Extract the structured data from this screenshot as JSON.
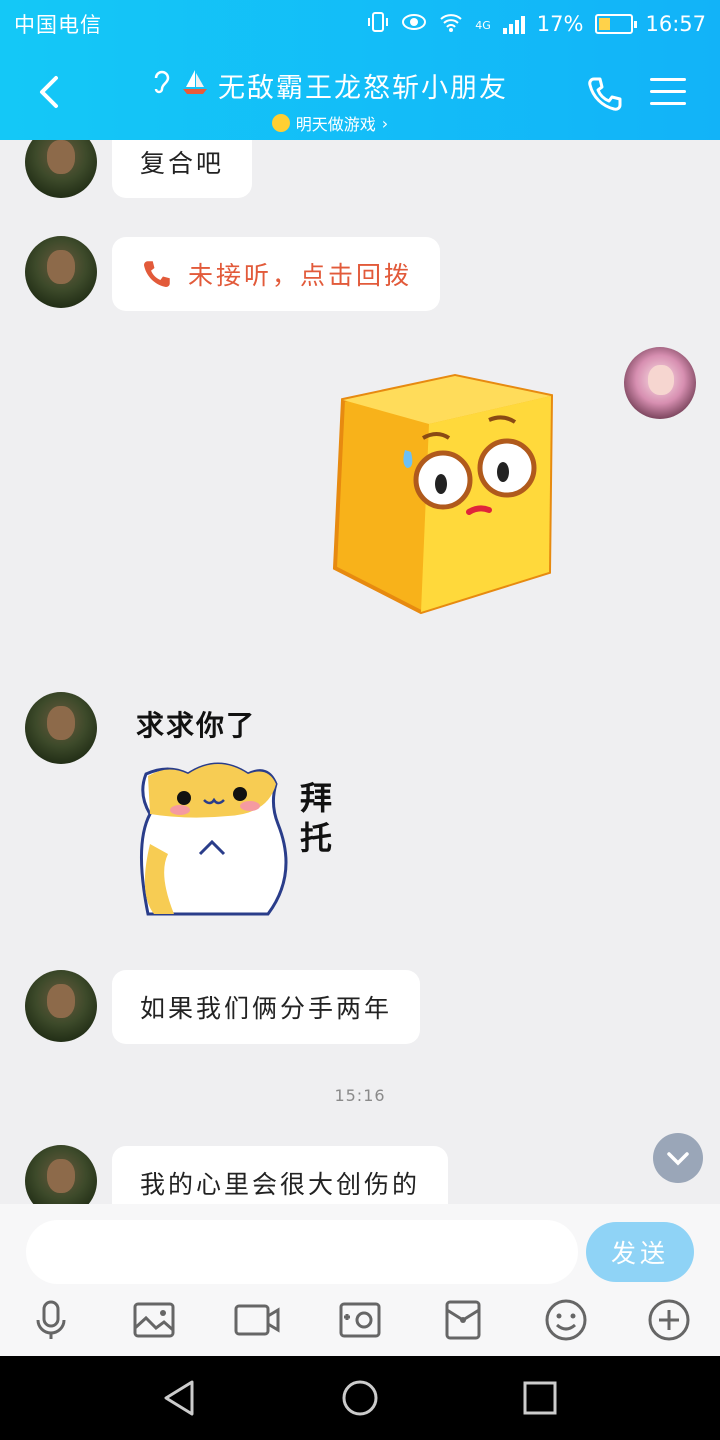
{
  "status_bar": {
    "carrier": "中国电信",
    "network": "4G",
    "battery": "17%",
    "time": "16:57"
  },
  "header": {
    "title": "无敌霸王龙怒斩小朋友",
    "subtitle": "明天做游戏"
  },
  "messages": {
    "m1": "复合吧",
    "m2": "未接听，点击回拨",
    "sticker_hamster_top": "求求你了",
    "sticker_hamster_side": "拜托",
    "m3": "如果我们俩分手两年",
    "timestamp": "15:16",
    "m4": "我的心里会很大创伤的"
  },
  "input": {
    "value": "",
    "placeholder": "",
    "send_label": "发送"
  },
  "icons": {
    "toolbar": [
      "microphone-icon",
      "image-icon",
      "video-icon",
      "camera-icon",
      "red-packet-icon",
      "emoji-icon",
      "plus-icon"
    ],
    "nav": [
      "back-triangle-icon",
      "home-circle-icon",
      "recent-square-icon"
    ]
  },
  "colors": {
    "header": "#12b3f8",
    "missed_call": "#e25a3a",
    "send_button": "#8fd3f6"
  }
}
